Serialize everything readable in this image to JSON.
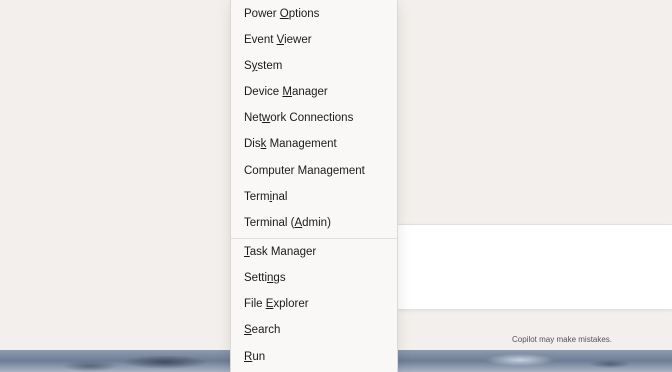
{
  "background_app": {
    "disclaimer": "Copilot may make mistakes."
  },
  "menu": {
    "items": [
      {
        "id": "power-options",
        "pre": "Power ",
        "key": "O",
        "post": "ptions"
      },
      {
        "id": "event-viewer",
        "pre": "Event ",
        "key": "V",
        "post": "iewer"
      },
      {
        "id": "system",
        "pre": "S",
        "key": "y",
        "post": "stem"
      },
      {
        "id": "device-manager",
        "pre": "Device ",
        "key": "M",
        "post": "anager"
      },
      {
        "id": "network-connections",
        "pre": "Net",
        "key": "w",
        "post": "ork Connections"
      },
      {
        "id": "disk-management",
        "pre": "Dis",
        "key": "k",
        "post": " Management"
      },
      {
        "id": "computer-management",
        "pre": "Computer Mana",
        "key": "g",
        "post": "ement"
      },
      {
        "id": "terminal",
        "pre": "Term",
        "key": "i",
        "post": "nal"
      },
      {
        "id": "terminal-admin",
        "pre": "Terminal (",
        "key": "A",
        "post": "dmin)"
      },
      {
        "id": "task-manager",
        "pre": "",
        "key": "T",
        "post": "ask Manager"
      },
      {
        "id": "settings",
        "pre": "Setti",
        "key": "n",
        "post": "gs"
      },
      {
        "id": "file-explorer",
        "pre": "File ",
        "key": "E",
        "post": "xplorer"
      },
      {
        "id": "search",
        "pre": "",
        "key": "S",
        "post": "earch"
      },
      {
        "id": "run",
        "pre": "",
        "key": "R",
        "post": "un"
      }
    ]
  }
}
